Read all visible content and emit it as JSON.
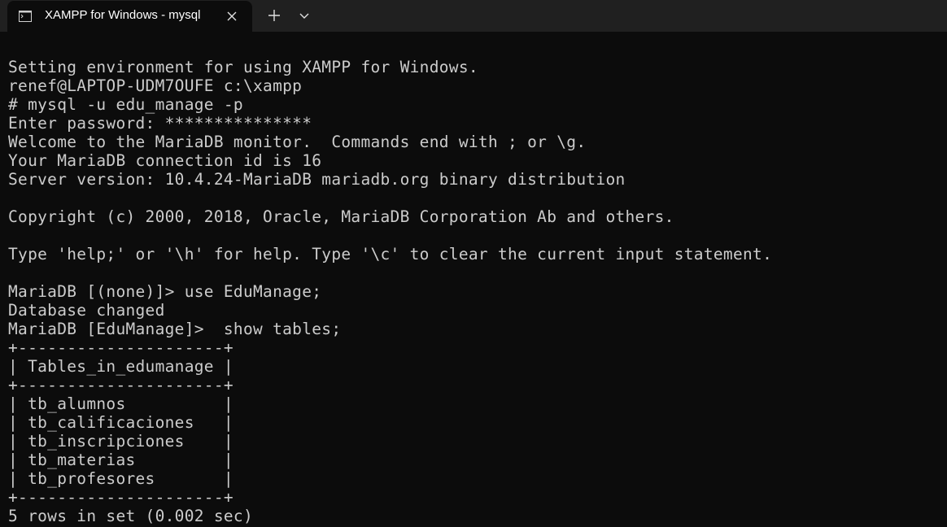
{
  "window": {
    "tab_title": "XAMPP for Windows - mysql"
  },
  "icons": {
    "tab_icon": "terminal-icon",
    "close": "close-icon",
    "new_tab": "plus-icon",
    "dropdown": "chevron-down-icon"
  },
  "colors": {
    "background": "#0c0c0c",
    "tabbar": "#202020",
    "text": "#cccccc"
  },
  "terminal": {
    "lines": [
      "Setting environment for using XAMPP for Windows.",
      "renef@LAPTOP-UDM7OUFE c:\\xampp",
      "# mysql -u edu_manage -p",
      "Enter password: ***************",
      "Welcome to the MariaDB monitor.  Commands end with ; or \\g.",
      "Your MariaDB connection id is 16",
      "Server version: 10.4.24-MariaDB mariadb.org binary distribution",
      "",
      "Copyright (c) 2000, 2018, Oracle, MariaDB Corporation Ab and others.",
      "",
      "Type 'help;' or '\\h' for help. Type '\\c' to clear the current input statement.",
      "",
      "MariaDB [(none)]> use EduManage;",
      "Database changed",
      "MariaDB [EduManage]>  show tables;",
      "+---------------------+",
      "| Tables_in_edumanage |",
      "+---------------------+",
      "| tb_alumnos          |",
      "| tb_calificaciones   |",
      "| tb_inscripciones    |",
      "| tb_materias         |",
      "| tb_profesores       |",
      "+---------------------+",
      "5 rows in set (0.002 sec)"
    ]
  }
}
